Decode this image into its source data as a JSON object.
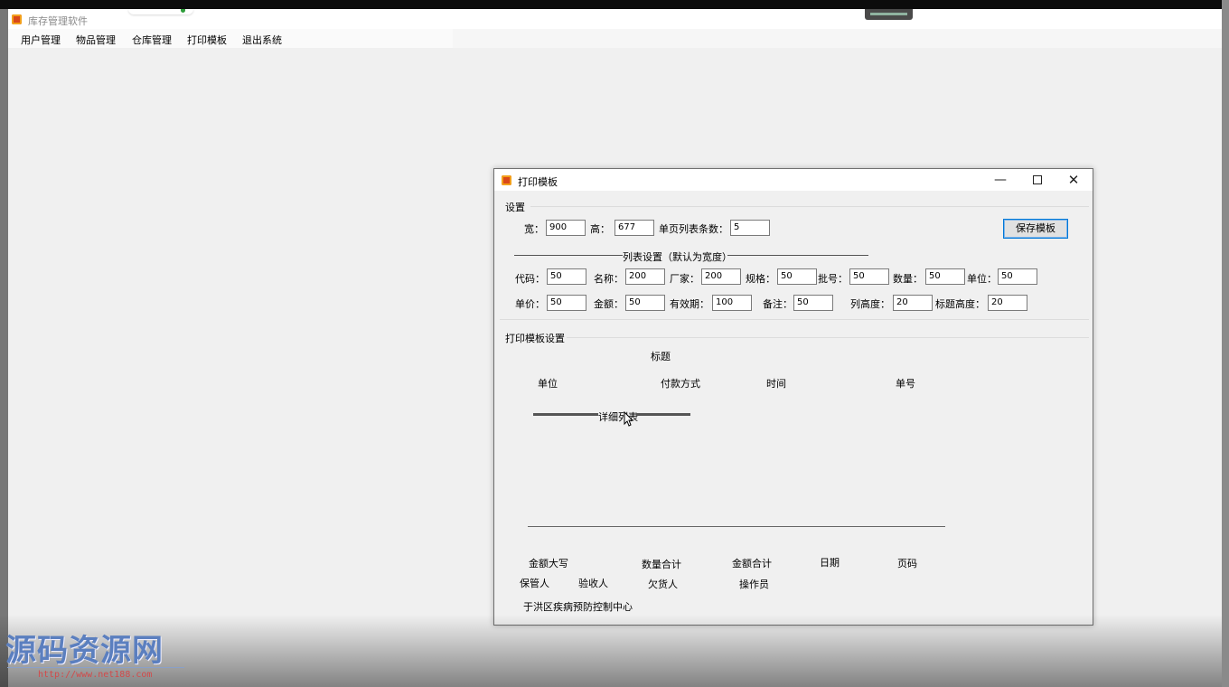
{
  "main_window": {
    "title": "库存管理软件",
    "menu": [
      "用户管理",
      "物品管理",
      "仓库管理",
      "打印模板",
      "退出系统"
    ]
  },
  "dialog": {
    "title": "打印模板",
    "controls": {
      "minimize": "—",
      "maximize": "",
      "close": "✕"
    },
    "settings_group": {
      "title": "设置",
      "width_label": "宽：",
      "width_value": "900",
      "height_label": "高：",
      "height_value": "677",
      "rows_label": "单页列表条数：",
      "rows_value": "5",
      "save_button": "保存模板",
      "list_section_title": "列表设置（默认为宽度）",
      "row1": [
        {
          "label": "代码：",
          "value": "50"
        },
        {
          "label": "名称：",
          "value": "200"
        },
        {
          "label": "厂家：",
          "value": "200"
        },
        {
          "label": "规格：",
          "value": "50"
        },
        {
          "label": "批号：",
          "value": "50"
        },
        {
          "label": "数量：",
          "value": "50"
        },
        {
          "label": "单位：",
          "value": "50"
        }
      ],
      "row2": [
        {
          "label": "单价：",
          "value": "50"
        },
        {
          "label": "金额：",
          "value": "50"
        },
        {
          "label": "有效期：",
          "value": "100"
        },
        {
          "label": "备注：",
          "value": "50"
        },
        {
          "label": "列高度：",
          "value": "20"
        },
        {
          "label": "标题高度：",
          "value": "20"
        }
      ]
    },
    "template_group": {
      "title": "打印模板设置",
      "heading": "标题",
      "unit": "单位",
      "payment_method": "付款方式",
      "time": "时间",
      "order_no": "单号",
      "detail_list": "详细列表",
      "amount_in_words": "金额大写",
      "quantity_total": "数量合计",
      "amount_total": "金额合计",
      "date": "日期",
      "page_no": "页码",
      "keeper": "保管人",
      "inspector": "验收人",
      "debtor": "欠货人",
      "operator": "操作员",
      "organization": "于洪区疾病预防控制中心"
    }
  },
  "watermark": {
    "text": "源码资源网",
    "url": "http://www.net188.com"
  }
}
